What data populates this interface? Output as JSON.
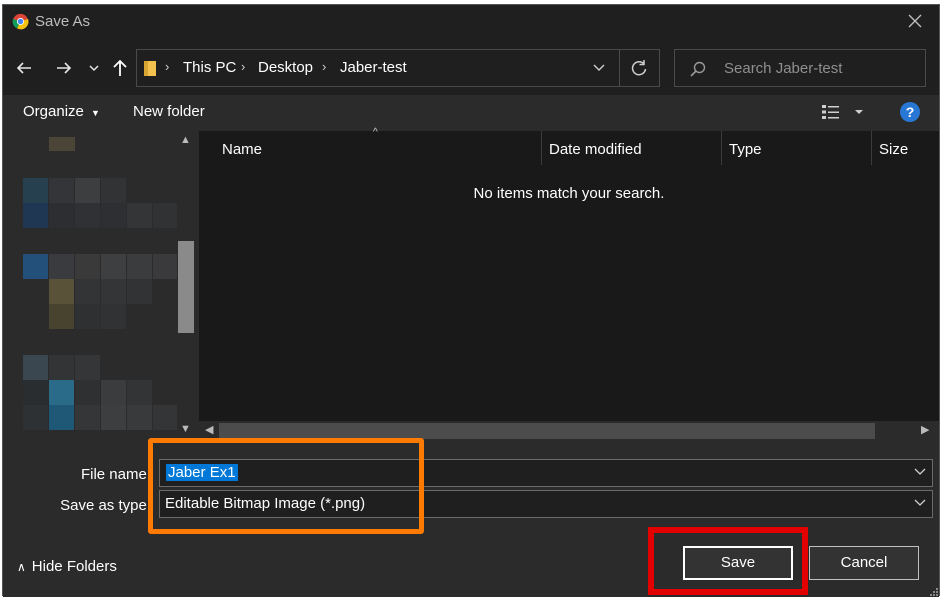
{
  "window": {
    "title": "Save As",
    "close_icon": "close-icon"
  },
  "navigation": {
    "breadcrumbs": [
      "This PC",
      "Desktop",
      "Jaber-test"
    ],
    "search_placeholder": "Search Jaber-test"
  },
  "toolbar": {
    "organize_label": "Organize",
    "new_folder_label": "New folder"
  },
  "file_list": {
    "columns": [
      "Name",
      "Date modified",
      "Type",
      "Size"
    ],
    "empty_message": "No items match your search."
  },
  "form": {
    "file_name_label": "File name:",
    "file_name_value": "Jaber Ex1",
    "save_as_type_label": "Save as type:",
    "save_as_type_value": "Editable Bitmap Image (*.png)"
  },
  "footer": {
    "hide_folders_label": "Hide Folders",
    "save_label": "Save",
    "cancel_label": "Cancel"
  },
  "colors": {
    "dialog_bg": "#2b2b2b",
    "title_bg": "#1f1f1f",
    "selection": "#0078d7",
    "help_icon": "#2977d4",
    "highlight_orange": "#ff7a00",
    "highlight_red": "#e30000"
  }
}
